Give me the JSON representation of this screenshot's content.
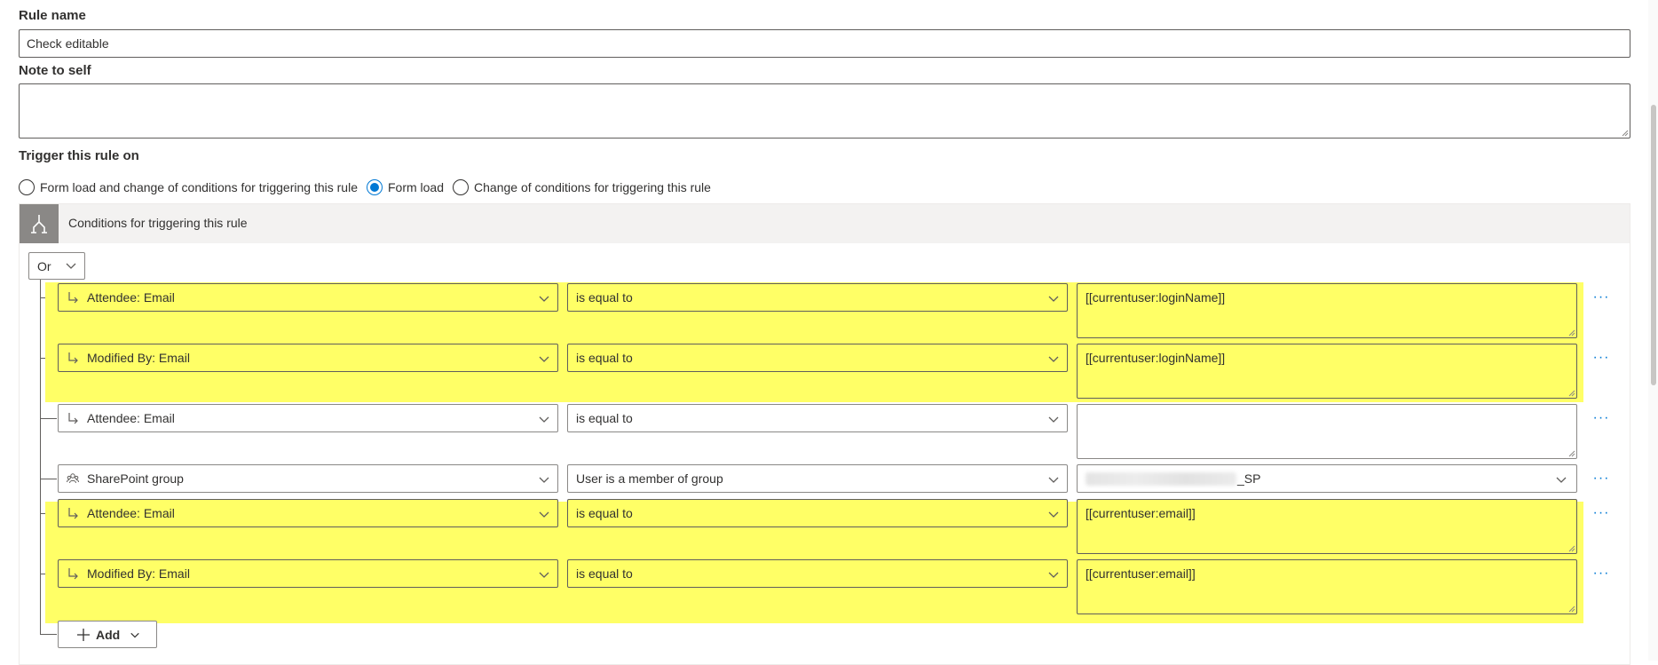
{
  "rule_name": {
    "label": "Rule name",
    "value": "Check editable"
  },
  "note": {
    "label": "Note to self",
    "value": ""
  },
  "trigger": {
    "label": "Trigger this rule on",
    "options": [
      {
        "label": "Form load and change of conditions for triggering this rule",
        "checked": false
      },
      {
        "label": "Form load",
        "checked": true
      },
      {
        "label": "Change of conditions for triggering this rule",
        "checked": false
      }
    ]
  },
  "conditions": {
    "title": "Conditions for triggering this rule",
    "operator": "Or",
    "rows": [
      {
        "field": "Attendee: Email",
        "comparison": "is equal to",
        "value": "[[currentuser:loginName]]",
        "highlighted": true,
        "more": "···"
      },
      {
        "field": "Modified By: Email",
        "comparison": "is equal to",
        "value": "[[currentuser:loginName]]",
        "highlighted": true,
        "more": "···"
      },
      {
        "field": "Attendee: Email",
        "comparison": "is equal to",
        "value": "",
        "highlighted": false,
        "more": "···"
      },
      {
        "field": "SharePoint group",
        "comparison": "User is a member of group",
        "value": "_SP",
        "highlighted": false,
        "more": "···"
      },
      {
        "field": "Attendee: Email",
        "comparison": "is equal to",
        "value": "[[currentuser:email]]",
        "highlighted": true,
        "more": "···"
      },
      {
        "field": "Modified By: Email",
        "comparison": "is equal to",
        "value": "[[currentuser:email]]",
        "highlighted": true,
        "more": "···"
      }
    ],
    "add_label": "Add"
  },
  "colors": {
    "accent": "#0078d4",
    "highlight": "#ffff66",
    "header_bg": "#f3f2f1",
    "icon_bg": "#8a8886"
  },
  "icons": {
    "field": "field-reference-icon",
    "group": "people-group-icon",
    "chevron": "chevron-down-icon",
    "conditions": "branch-icon",
    "add": "plus-icon",
    "more": "more-icon"
  }
}
